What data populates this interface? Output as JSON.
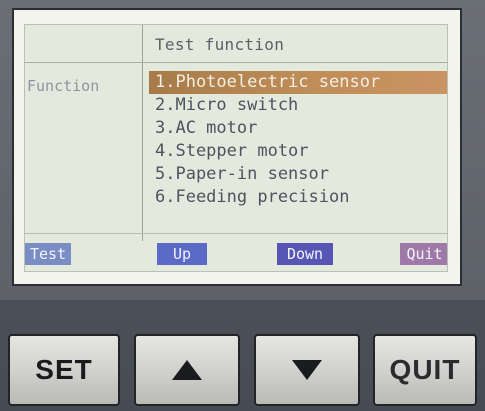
{
  "screen": {
    "title": "Test function",
    "function_label": "Function",
    "menu": [
      {
        "label": "1.Photoelectric sensor",
        "selected": true
      },
      {
        "label": "2.Micro switch",
        "selected": false
      },
      {
        "label": "3.AC motor",
        "selected": false
      },
      {
        "label": "4.Stepper motor",
        "selected": false
      },
      {
        "label": "5.Paper-in sensor",
        "selected": false
      },
      {
        "label": "6.Feeding precision",
        "selected": false
      }
    ],
    "softkeys": {
      "test": "Test",
      "up": "Up",
      "down": "Down",
      "quit": "Quit"
    }
  },
  "hardware_buttons": {
    "set": "SET",
    "up_icon": "triangle-up-icon",
    "down_icon": "triangle-down-icon",
    "quit": "QUIT"
  },
  "colors": {
    "selection": "#b98855",
    "softkey_test": "#7a8cc4",
    "softkey_up": "#5b69c7",
    "softkey_down": "#5856b5",
    "softkey_quit": "#9f7aa8",
    "lcd_background": "#e4e9dd"
  }
}
